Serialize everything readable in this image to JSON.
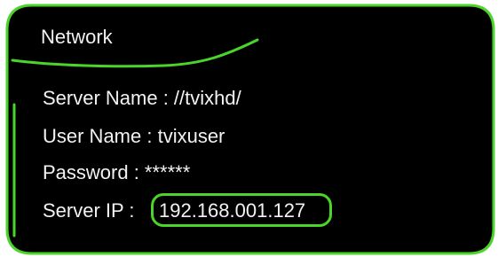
{
  "panel": {
    "title": "Network",
    "accent_color": "#4bd42a",
    "background_color": "#000000"
  },
  "fields": {
    "server_name": "Server Name : //tvixhd/",
    "user_name": "User Name : tvixuser",
    "password": "Password : ******",
    "server_ip_label": "Server IP :",
    "server_ip_value": "192.168.001.127"
  }
}
